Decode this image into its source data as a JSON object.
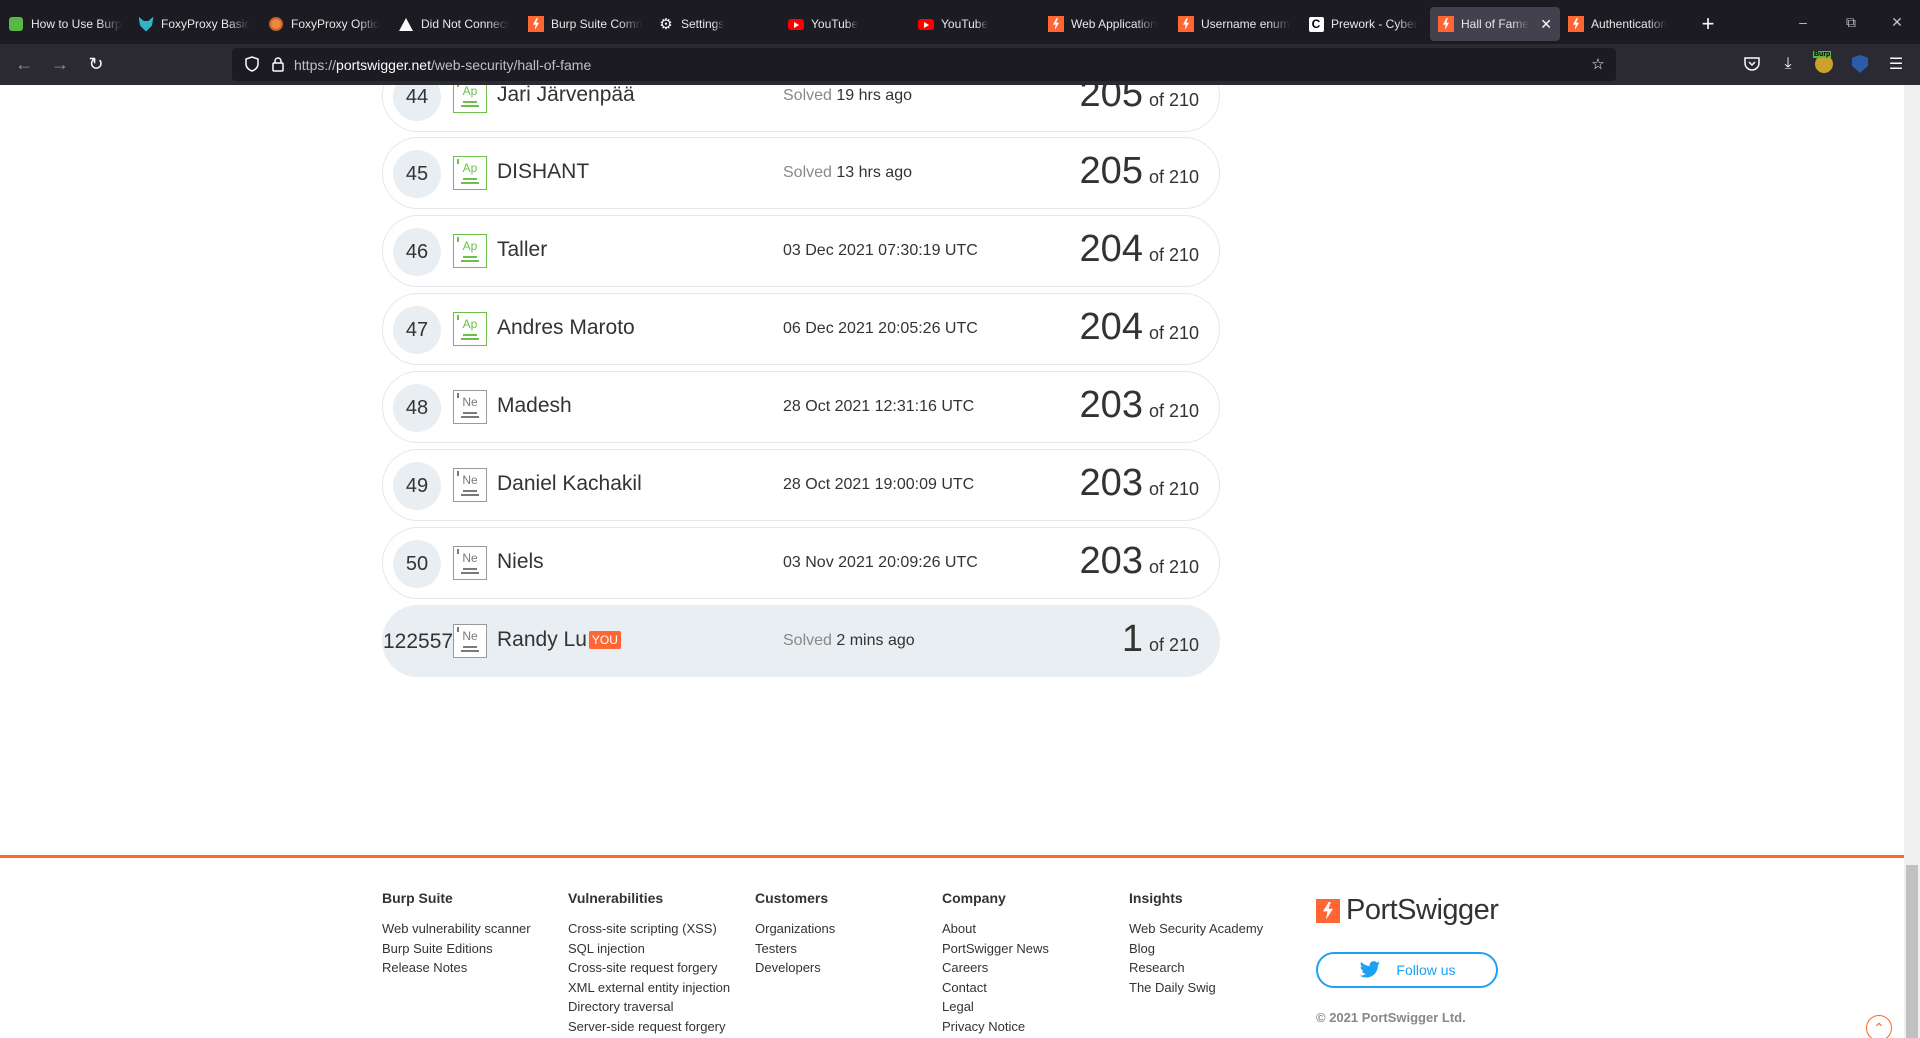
{
  "tabs": [
    {
      "label": "How to Use Burp",
      "icon": "green-app-icon"
    },
    {
      "label": "FoxyProxy Basic",
      "icon": "foxyproxy-icon"
    },
    {
      "label": "FoxyProxy Optio",
      "icon": "foxyproxy-options-icon"
    },
    {
      "label": "Did Not Connect",
      "icon": "warning-icon"
    },
    {
      "label": "Burp Suite Comm",
      "icon": "portswigger-icon"
    },
    {
      "label": "Settings",
      "icon": "gear-icon"
    },
    {
      "label": "YouTube",
      "icon": "youtube-icon"
    },
    {
      "label": "YouTube",
      "icon": "youtube-icon"
    },
    {
      "label": "Web Application",
      "icon": "portswigger-icon"
    },
    {
      "label": "Username enum",
      "icon": "portswigger-icon"
    },
    {
      "label": "Prework - Cyber",
      "icon": "c-icon"
    },
    {
      "label": "Hall of Fame",
      "icon": "portswigger-icon",
      "active": true
    },
    {
      "label": "Authentication",
      "icon": "portswigger-icon"
    }
  ],
  "url": {
    "scheme": "https://",
    "host": "portswigger.net",
    "path": "/web-security/hall-of-fame"
  },
  "leaderboard": {
    "rows": [
      {
        "rank": "44",
        "level": "Ap",
        "name": "Jari Järvenpää",
        "date_prefix": "Solved",
        "date": "19 hrs ago",
        "score": "205",
        "of": "of 210"
      },
      {
        "rank": "45",
        "level": "Ap",
        "name": "DISHANT",
        "date_prefix": "Solved",
        "date": "13 hrs ago",
        "score": "205",
        "of": "of 210"
      },
      {
        "rank": "46",
        "level": "Ap",
        "name": "Taller",
        "date_prefix": "",
        "date": "03 Dec 2021 07:30:19 UTC",
        "score": "204",
        "of": "of 210"
      },
      {
        "rank": "47",
        "level": "Ap",
        "name": "Andres Maroto",
        "date_prefix": "",
        "date": "06 Dec 2021 20:05:26 UTC",
        "score": "204",
        "of": "of 210"
      },
      {
        "rank": "48",
        "level": "Ne",
        "name": "Madesh",
        "date_prefix": "",
        "date": "28 Oct 2021 12:31:16 UTC",
        "score": "203",
        "of": "of 210"
      },
      {
        "rank": "49",
        "level": "Ne",
        "name": "Daniel Kachakil",
        "date_prefix": "",
        "date": "28 Oct 2021 19:00:09 UTC",
        "score": "203",
        "of": "of 210"
      },
      {
        "rank": "50",
        "level": "Ne",
        "name": "Niels",
        "date_prefix": "",
        "date": "03 Nov 2021 20:09:26 UTC",
        "score": "203",
        "of": "of 210"
      }
    ],
    "you": {
      "rank": "122557",
      "level": "Ne",
      "name": "Randy Lu",
      "tag": "YOU",
      "date_prefix": "Solved",
      "date": "2 mins ago",
      "score": "1",
      "of": "of 210"
    }
  },
  "footer": {
    "columns": [
      {
        "heading": "Burp Suite",
        "links": [
          "Web vulnerability scanner",
          "Burp Suite Editions",
          "Release Notes"
        ]
      },
      {
        "heading": "Vulnerabilities",
        "links": [
          "Cross-site scripting (XSS)",
          "SQL injection",
          "Cross-site request forgery",
          "XML external entity injection",
          "Directory traversal",
          "Server-side request forgery"
        ]
      },
      {
        "heading": "Customers",
        "links": [
          "Organizations",
          "Testers",
          "Developers"
        ]
      },
      {
        "heading": "Company",
        "links": [
          "About",
          "PortSwigger News",
          "Careers",
          "Contact",
          "Legal",
          "Privacy Notice"
        ]
      },
      {
        "heading": "Insights",
        "links": [
          "Web Security Academy",
          "Blog",
          "Research",
          "The Daily Swig"
        ]
      }
    ],
    "logo_text": "PortSwigger",
    "follow_label": "Follow us",
    "copyright": "© 2021 PortSwigger Ltd."
  },
  "colors": {
    "accent": "#ff6633",
    "twitter": "#1da1f2",
    "apprentice": "#6cc04a",
    "neophyte": "#9a9a9a"
  }
}
